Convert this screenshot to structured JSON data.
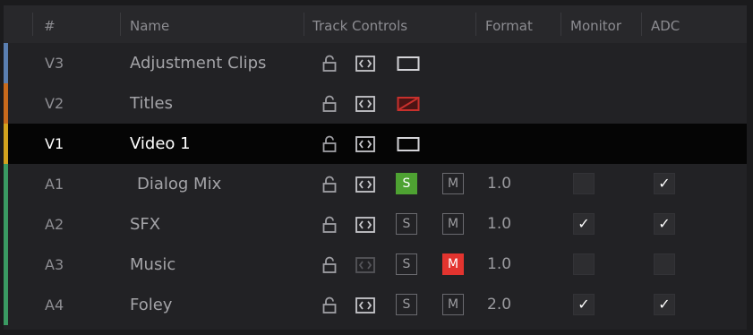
{
  "header": {
    "number": "#",
    "name": "Name",
    "track_controls": "Track Controls",
    "format": "Format",
    "monitor": "Monitor",
    "adc": "ADC"
  },
  "colors": {
    "video_bar_v3": "#5a7fb2",
    "video_bar_v2": "#c86a1c",
    "video_bar_v1": "#d2a21e",
    "audio_bar": "#3a9a62",
    "solo_on": "#4ea232",
    "mute_on": "#e3342f",
    "disabled_icon": "#c8302c"
  },
  "tracks": [
    {
      "id": "V3",
      "name": "Adjustment Clips",
      "kind": "video",
      "bar": "video_bar_v3",
      "locked": false,
      "auto_select": true,
      "enabled": true
    },
    {
      "id": "V2",
      "name": "Titles",
      "kind": "video",
      "bar": "video_bar_v2",
      "locked": false,
      "auto_select": true,
      "enabled": false
    },
    {
      "id": "V1",
      "name": "Video 1",
      "kind": "video",
      "bar": "video_bar_v1",
      "selected": true,
      "locked": false,
      "auto_select": true,
      "enabled": true
    },
    {
      "id": "A1",
      "name": "Dialog Mix",
      "kind": "audio",
      "bar": "audio_bar",
      "auto_select": true,
      "solo": true,
      "mute": false,
      "format": "1.0",
      "monitor": false,
      "adc": true,
      "solo_label": "S",
      "mute_label": "M"
    },
    {
      "id": "A2",
      "name": "SFX",
      "kind": "audio",
      "bar": "audio_bar",
      "auto_select": true,
      "solo": false,
      "mute": false,
      "format": "1.0",
      "monitor": true,
      "adc": true,
      "solo_label": "S",
      "mute_label": "M"
    },
    {
      "id": "A3",
      "name": "Music",
      "kind": "audio",
      "bar": "audio_bar",
      "auto_select": false,
      "solo": false,
      "mute": true,
      "format": "1.0",
      "monitor": false,
      "adc": false,
      "solo_label": "S",
      "mute_label": "M"
    },
    {
      "id": "A4",
      "name": "Foley",
      "kind": "audio",
      "bar": "audio_bar",
      "auto_select": true,
      "solo": false,
      "mute": false,
      "format": "2.0",
      "monitor": true,
      "adc": true,
      "solo_label": "S",
      "mute_label": "M"
    }
  ],
  "icons": {
    "lock": "lock-icon",
    "auto_select": "auto-select-icon",
    "track_enable": "track-enable-icon",
    "checkmark": "✓"
  }
}
